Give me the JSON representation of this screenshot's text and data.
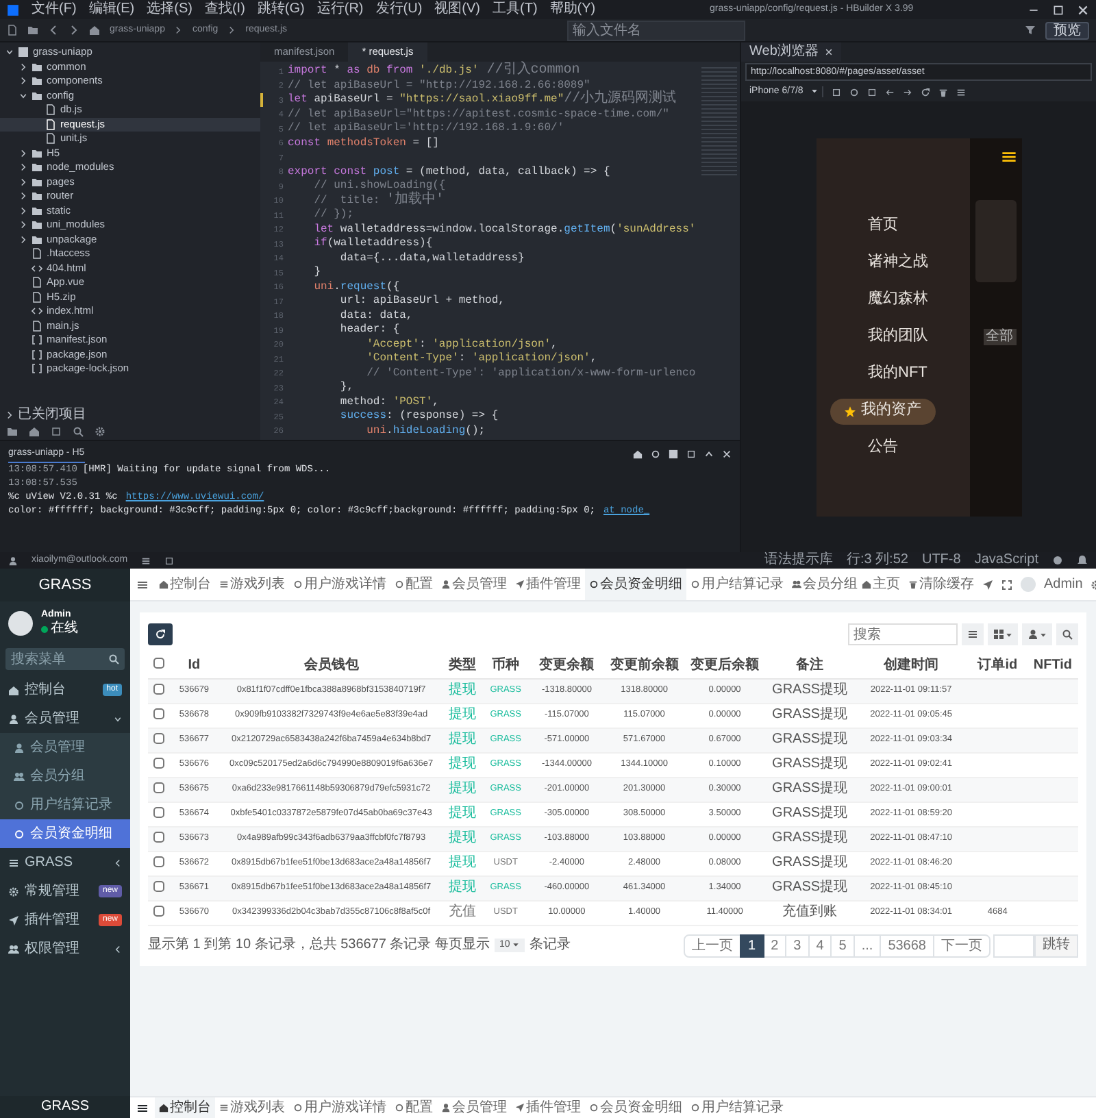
{
  "ide": {
    "menu": [
      "文件(F)",
      "编辑(E)",
      "选择(S)",
      "查找(I)",
      "跳转(G)",
      "运行(R)",
      "发行(U)",
      "视图(V)",
      "工具(T)",
      "帮助(Y)"
    ],
    "title": "grass-uniapp/config/request.js - HBuilder X 3.99",
    "breadcrumb": [
      "grass-uniapp",
      "config",
      "request.js"
    ],
    "file_search": {
      "placeholder": "输入文件名"
    },
    "preview_button": "预览",
    "file_tree": [
      {
        "label": "grass-uniapp",
        "kind": "project",
        "expanded": true,
        "selected": false,
        "children": [
          {
            "label": "common",
            "kind": "folder",
            "expanded": false,
            "selected": false
          },
          {
            "label": "components",
            "kind": "folder",
            "expanded": false,
            "selected": false
          },
          {
            "label": "config",
            "kind": "folder",
            "expanded": true,
            "selected": false,
            "children": [
              {
                "label": "db.js",
                "kind": "file",
                "selected": false
              },
              {
                "label": "request.js",
                "kind": "file",
                "selected": true
              },
              {
                "label": "unit.js",
                "kind": "file",
                "selected": false
              }
            ]
          },
          {
            "label": "H5",
            "kind": "folder",
            "expanded": false,
            "selected": false
          },
          {
            "label": "node_modules",
            "kind": "folder",
            "expanded": false,
            "selected": false
          },
          {
            "label": "pages",
            "kind": "folder",
            "expanded": false,
            "selected": false
          },
          {
            "label": "router",
            "kind": "folder",
            "expanded": false,
            "selected": false
          },
          {
            "label": "static",
            "kind": "folder",
            "expanded": false,
            "selected": false
          },
          {
            "label": "uni_modules",
            "kind": "folder",
            "expanded": false,
            "selected": false
          },
          {
            "label": "unpackage",
            "kind": "folder",
            "expanded": false,
            "selected": false
          },
          {
            "label": ".htaccess",
            "kind": "file",
            "selected": false
          },
          {
            "label": "404.html",
            "kind": "markup",
            "selected": false
          },
          {
            "label": "App.vue",
            "kind": "file",
            "selected": false
          },
          {
            "label": "H5.zip",
            "kind": "file",
            "selected": false
          },
          {
            "label": "index.html",
            "kind": "markup",
            "selected": false
          },
          {
            "label": "main.js",
            "kind": "file",
            "selected": false
          },
          {
            "label": "manifest.json",
            "kind": "json",
            "selected": false
          },
          {
            "label": "package.json",
            "kind": "json",
            "selected": false
          },
          {
            "label": "package-lock.json",
            "kind": "json",
            "selected": false
          }
        ]
      }
    ],
    "closed_projects": {
      "label": "已关闭项目",
      "expanded": false
    },
    "editor_tabs": [
      {
        "label": "manifest.json",
        "selected": false
      },
      {
        "label": "* request.js",
        "selected": true
      }
    ],
    "code_lines": [
      {
        "num": "1",
        "modified": false,
        "tokens": [
          {
            "kind": "kw",
            "text": "import"
          },
          {
            "kind": "pl",
            "text": " * "
          },
          {
            "kind": "kw",
            "text": "as"
          },
          {
            "kind": "var",
            "text": " db "
          },
          {
            "kind": "kw",
            "text": "from"
          },
          {
            "kind": "str",
            "text": " './db.js'"
          },
          {
            "kind": "note",
            "text": " //引入common"
          }
        ]
      },
      {
        "num": "2",
        "modified": false,
        "tokens": [
          {
            "kind": "cmt",
            "text": "// let apiBaseUrl = \"http://192.168.2.66:8089\""
          }
        ]
      },
      {
        "num": "3",
        "modified": true,
        "tokens": [
          {
            "kind": "kw",
            "text": "let"
          },
          {
            "kind": "pl",
            "text": " apiBaseUrl = "
          },
          {
            "kind": "str",
            "text": "\"https://saol.xiao9ff.me\""
          },
          {
            "kind": "note",
            "text": "//小九源码网测试"
          }
        ]
      },
      {
        "num": "4",
        "modified": false,
        "tokens": [
          {
            "kind": "cmt",
            "text": "// let apiBaseUrl=\"https://apitest.cosmic-space-time.com/\""
          }
        ]
      },
      {
        "num": "5",
        "modified": false,
        "tokens": [
          {
            "kind": "cmt",
            "text": "// let apiBaseUrl='http://192.168.1.9:60/'"
          }
        ]
      },
      {
        "num": "6",
        "modified": false,
        "tokens": [
          {
            "kind": "kw",
            "text": "const"
          },
          {
            "kind": "var",
            "text": " methodsToken"
          },
          {
            "kind": "pl",
            "text": " = []"
          }
        ]
      },
      {
        "num": "7",
        "modified": false
      },
      {
        "num": "8",
        "modified": false,
        "tokens": [
          {
            "kind": "kw",
            "text": "export const"
          },
          {
            "kind": "fn",
            "text": " post"
          },
          {
            "kind": "pl",
            "text": " = (method, data, callback) => {"
          }
        ]
      },
      {
        "num": "9",
        "modified": false,
        "tokens": [
          {
            "kind": "cmt",
            "text": "    // uni.showLoading({"
          }
        ]
      },
      {
        "num": "10",
        "modified": false,
        "tokens": [
          {
            "kind": "cmt",
            "text": "    //  title: "
          },
          {
            "kind": "note",
            "text": "'加载中'"
          }
        ]
      },
      {
        "num": "11",
        "modified": false,
        "tokens": [
          {
            "kind": "cmt",
            "text": "    // });"
          }
        ]
      },
      {
        "num": "12",
        "modified": false,
        "tokens": [
          {
            "kind": "kw",
            "text": "    let"
          },
          {
            "kind": "pl",
            "text": " walletaddress=window.localStorage."
          },
          {
            "kind": "fn",
            "text": "getItem"
          },
          {
            "kind": "pl",
            "text": "("
          },
          {
            "kind": "str",
            "text": "'sunAddress'"
          }
        ]
      },
      {
        "num": "13",
        "modified": false,
        "tokens": [
          {
            "kind": "kw",
            "text": "    if"
          },
          {
            "kind": "pl",
            "text": "(walletaddress){"
          }
        ]
      },
      {
        "num": "14",
        "modified": false,
        "tokens": [
          {
            "kind": "pl",
            "text": "        data={...data,walletaddress}"
          }
        ]
      },
      {
        "num": "15",
        "modified": false,
        "tokens": [
          {
            "kind": "pl",
            "text": "    }"
          }
        ]
      },
      {
        "num": "16",
        "modified": false,
        "tokens": [
          {
            "kind": "var",
            "text": "    uni"
          },
          {
            "kind": "pl",
            "text": "."
          },
          {
            "kind": "fn",
            "text": "request"
          },
          {
            "kind": "pl",
            "text": "({"
          }
        ]
      },
      {
        "num": "17",
        "modified": false,
        "tokens": [
          {
            "kind": "pl",
            "text": "        url: apiBaseUrl + method,"
          }
        ]
      },
      {
        "num": "18",
        "modified": false,
        "tokens": [
          {
            "kind": "pl",
            "text": "        data: data,"
          }
        ]
      },
      {
        "num": "19",
        "modified": false,
        "tokens": [
          {
            "kind": "pl",
            "text": "        header: {"
          }
        ]
      },
      {
        "num": "20",
        "modified": false,
        "tokens": [
          {
            "kind": "str",
            "text": "            'Accept'"
          },
          {
            "kind": "pl",
            "text": ": "
          },
          {
            "kind": "str",
            "text": "'application/json'"
          },
          {
            "kind": "pl",
            "text": ","
          }
        ]
      },
      {
        "num": "21",
        "modified": false,
        "tokens": [
          {
            "kind": "str",
            "text": "            'Content-Type'"
          },
          {
            "kind": "pl",
            "text": ": "
          },
          {
            "kind": "str",
            "text": "'application/json'"
          },
          {
            "kind": "pl",
            "text": ","
          }
        ]
      },
      {
        "num": "22",
        "modified": false,
        "tokens": [
          {
            "kind": "cmt",
            "text": "            // 'Content-Type': 'application/x-www-form-urlenco"
          }
        ]
      },
      {
        "num": "23",
        "modified": false,
        "tokens": [
          {
            "kind": "pl",
            "text": "        },"
          }
        ]
      },
      {
        "num": "24",
        "modified": false,
        "tokens": [
          {
            "kind": "pl",
            "text": "        method: "
          },
          {
            "kind": "str",
            "text": "'POST'"
          },
          {
            "kind": "pl",
            "text": ","
          }
        ]
      },
      {
        "num": "25",
        "modified": false,
        "tokens": [
          {
            "kind": "fn",
            "text": "        success"
          },
          {
            "kind": "pl",
            "text": ": (response) => {"
          }
        ]
      },
      {
        "num": "26",
        "modified": false,
        "tokens": [
          {
            "kind": "var",
            "text": "            uni"
          },
          {
            "kind": "pl",
            "text": "."
          },
          {
            "kind": "fn",
            "text": "hideLoading"
          },
          {
            "kind": "pl",
            "text": "();"
          }
        ]
      }
    ],
    "browser": {
      "tab": "Web浏览器",
      "url": "http://localhost:8080/#/pages/asset/asset",
      "device": "iPhone 6/7/8",
      "phone_menu": [
        {
          "label": "首页",
          "selected": false
        },
        {
          "label": "诸神之战",
          "selected": false
        },
        {
          "label": "魔幻森林",
          "selected": false
        },
        {
          "label": "我的团队",
          "selected": false
        },
        {
          "label": "我的NFT",
          "selected": false
        },
        {
          "label": "我的资产",
          "selected": true
        },
        {
          "label": "公告",
          "selected": false
        }
      ],
      "filter": "全部"
    },
    "console": {
      "tab": "grass-uniapp - H5",
      "lines": [
        {
          "time": "13:08:57.410",
          "text": "[HMR] Waiting for update signal from WDS..."
        },
        {
          "time": "13:08:57.535"
        },
        {
          "text": "%c uView V2.0.31 %c",
          "link": "https://www.uviewui.com/"
        },
        {
          "text": "color: #ffffff; background: #3c9cff; padding:5px 0; color: #3c9cff;background: #ffffff; padding:5px 0;",
          "link": "at node_"
        }
      ]
    },
    "status_bar": {
      "account": "xiaoilym@outlook.com",
      "items": [
        "语法提示库",
        "行:3 列:52",
        "UTF-8",
        "JavaScript"
      ]
    }
  },
  "admin": {
    "brand": "GRASS",
    "user": {
      "name": "Admin",
      "status": "在线"
    },
    "menu_search": {
      "placeholder": "搜索菜单"
    },
    "sidebar": [
      {
        "label": "控制台",
        "selected": false,
        "badge": {
          "text": "hot",
          "color": "#3c8dbc"
        }
      },
      {
        "label": "会员管理",
        "selected": false,
        "expanded": true,
        "children": [
          {
            "label": "会员管理",
            "selected": false
          },
          {
            "label": "会员分组",
            "selected": false
          },
          {
            "label": "用户结算记录",
            "selected": false
          },
          {
            "label": "会员资金明细",
            "selected": true
          }
        ]
      },
      {
        "label": "GRASS",
        "selected": false,
        "expanded": false
      },
      {
        "label": "常规管理",
        "selected": false,
        "badge": {
          "text": "new",
          "color": "#605ca8"
        }
      },
      {
        "label": "插件管理",
        "selected": false,
        "badge": {
          "text": "new",
          "color": "#dd4b39"
        }
      },
      {
        "label": "权限管理",
        "selected": false,
        "expanded": false
      }
    ],
    "footer_brand": "GRASS",
    "tabs": [
      {
        "label": "控制台",
        "selected": false
      },
      {
        "label": "游戏列表",
        "selected": false
      },
      {
        "label": "用户游戏详情",
        "selected": false
      },
      {
        "label": "配置",
        "selected": false
      },
      {
        "label": "会员管理",
        "selected": false
      },
      {
        "label": "插件管理",
        "selected": false
      },
      {
        "label": "会员资金明细",
        "selected": true
      },
      {
        "label": "用户结算记录",
        "selected": false
      },
      {
        "label": "会员分组",
        "selected": false
      }
    ],
    "top_right": {
      "home": "主页",
      "clear_cache": "清除缓存",
      "user": "Admin"
    },
    "search": {
      "placeholder": "搜索"
    },
    "table": {
      "select_all": {
        "checked": false
      },
      "columns": [
        "Id",
        "会员钱包",
        "类型",
        "币种",
        "变更余额",
        "变更前余额",
        "变更后余额",
        "备注",
        "创建时间",
        "订单id",
        "NFTid"
      ],
      "rows": [
        {
          "checked": false,
          "id": "536679",
          "wallet": "0x81f1f07cdff0e1fbca388a8968bf3153840719f7",
          "type": {
            "text": "提现",
            "color": "#18bc9c"
          },
          "currency": {
            "text": "GRASS",
            "color": "#18bc9c"
          },
          "change": "-1318.80000",
          "before": "1318.80000",
          "after": "0.00000",
          "remark": "GRASS提现",
          "created": "2022-11-01 09:11:57"
        },
        {
          "checked": false,
          "id": "536678",
          "wallet": "0x909fb9103382f7329743f9e4e6ae5e83f39e4ad",
          "type": {
            "text": "提现",
            "color": "#18bc9c"
          },
          "currency": {
            "text": "GRASS",
            "color": "#18bc9c"
          },
          "change": "-115.07000",
          "before": "115.07000",
          "after": "0.00000",
          "remark": "GRASS提现",
          "created": "2022-11-01 09:05:45"
        },
        {
          "checked": false,
          "id": "536677",
          "wallet": "0x2120729ac6583438a242f6ba7459a4e634b8bd7",
          "type": {
            "text": "提现",
            "color": "#18bc9c"
          },
          "currency": {
            "text": "GRASS",
            "color": "#18bc9c"
          },
          "change": "-571.00000",
          "before": "571.67000",
          "after": "0.67000",
          "remark": "GRASS提现",
          "created": "2022-11-01 09:03:34"
        },
        {
          "checked": false,
          "id": "536676",
          "wallet": "0xc09c520175ed2a6d6c794990e8809019f6a636e7",
          "type": {
            "text": "提现",
            "color": "#18bc9c"
          },
          "currency": {
            "text": "GRASS",
            "color": "#18bc9c"
          },
          "change": "-1344.00000",
          "before": "1344.10000",
          "after": "0.10000",
          "remark": "GRASS提现",
          "created": "2022-11-01 09:02:41"
        },
        {
          "checked": false,
          "id": "536675",
          "wallet": "0xa6d233e9817661148b59306879d79efc5931c72",
          "type": {
            "text": "提现",
            "color": "#18bc9c"
          },
          "currency": {
            "text": "GRASS",
            "color": "#18bc9c"
          },
          "change": "-201.00000",
          "before": "201.30000",
          "after": "0.30000",
          "remark": "GRASS提现",
          "created": "2022-11-01 09:00:01"
        },
        {
          "checked": false,
          "id": "536674",
          "wallet": "0xbfe5401c0337872e5879fe07d45ab0ba69c37e43",
          "type": {
            "text": "提现",
            "color": "#18bc9c"
          },
          "currency": {
            "text": "GRASS",
            "color": "#18bc9c"
          },
          "change": "-305.00000",
          "before": "308.50000",
          "after": "3.50000",
          "remark": "GRASS提现",
          "created": "2022-11-01 08:59:20"
        },
        {
          "checked": false,
          "id": "536673",
          "wallet": "0x4a989afb99c343f6adb6379aa3ffcbf0fc7f8793",
          "type": {
            "text": "提现",
            "color": "#18bc9c"
          },
          "currency": {
            "text": "GRASS",
            "color": "#18bc9c"
          },
          "change": "-103.88000",
          "before": "103.88000",
          "after": "0.00000",
          "remark": "GRASS提现",
          "created": "2022-11-01 08:47:10"
        },
        {
          "checked": false,
          "id": "536672",
          "wallet": "0x8915db67b1fee51f0be13d683ace2a48a14856f7",
          "type": {
            "text": "提现",
            "color": "#18bc9c"
          },
          "currency": {
            "text": "USDT",
            "color": "#777777"
          },
          "change": "-2.40000",
          "before": "2.48000",
          "after": "0.08000",
          "remark": "GRASS提现",
          "created": "2022-11-01 08:46:20"
        },
        {
          "checked": false,
          "id": "536671",
          "wallet": "0x8915db67b1fee51f0be13d683ace2a48a14856f7",
          "type": {
            "text": "提现",
            "color": "#18bc9c"
          },
          "currency": {
            "text": "GRASS",
            "color": "#18bc9c"
          },
          "change": "-460.00000",
          "before": "461.34000",
          "after": "1.34000",
          "remark": "GRASS提现",
          "created": "2022-11-01 08:45:10"
        },
        {
          "checked": false,
          "id": "536670",
          "wallet": "0x342399336d2b04c3bab7d355c87106c8f8af5c0f",
          "type": {
            "text": "充值",
            "color": "#777777"
          },
          "currency": {
            "text": "USDT",
            "color": "#777777"
          },
          "change": "10.00000",
          "before": "1.40000",
          "after": "11.40000",
          "remark": "充值到账",
          "created": "2022-11-01 08:34:01",
          "order_id": "4684"
        }
      ]
    },
    "pagination_info": {
      "before": "显示第 1 到第 10 条记录，总共 536677 条记录 每页显示",
      "page_size": "10",
      "after": "条记录"
    },
    "pagination": {
      "pages": [
        {
          "label": "上一页",
          "selected": false
        },
        {
          "label": "1",
          "selected": true
        },
        {
          "label": "2",
          "selected": false
        },
        {
          "label": "3",
          "selected": false
        },
        {
          "label": "4",
          "selected": false
        },
        {
          "label": "5",
          "selected": false
        },
        {
          "label": "...",
          "selected": false
        },
        {
          "label": "53668",
          "selected": false
        },
        {
          "label": "下一页",
          "selected": false
        }
      ],
      "jump": "跳转"
    },
    "footer_tabs": [
      {
        "label": "控制台",
        "selected": true
      },
      {
        "label": "游戏列表",
        "selected": false
      },
      {
        "label": "用户游戏详情",
        "selected": false
      },
      {
        "label": "配置",
        "selected": false
      },
      {
        "label": "会员管理",
        "selected": false
      },
      {
        "label": "插件管理",
        "selected": false
      },
      {
        "label": "会员资金明细",
        "selected": false
      },
      {
        "label": "用户结算记录",
        "selected": false
      }
    ]
  }
}
